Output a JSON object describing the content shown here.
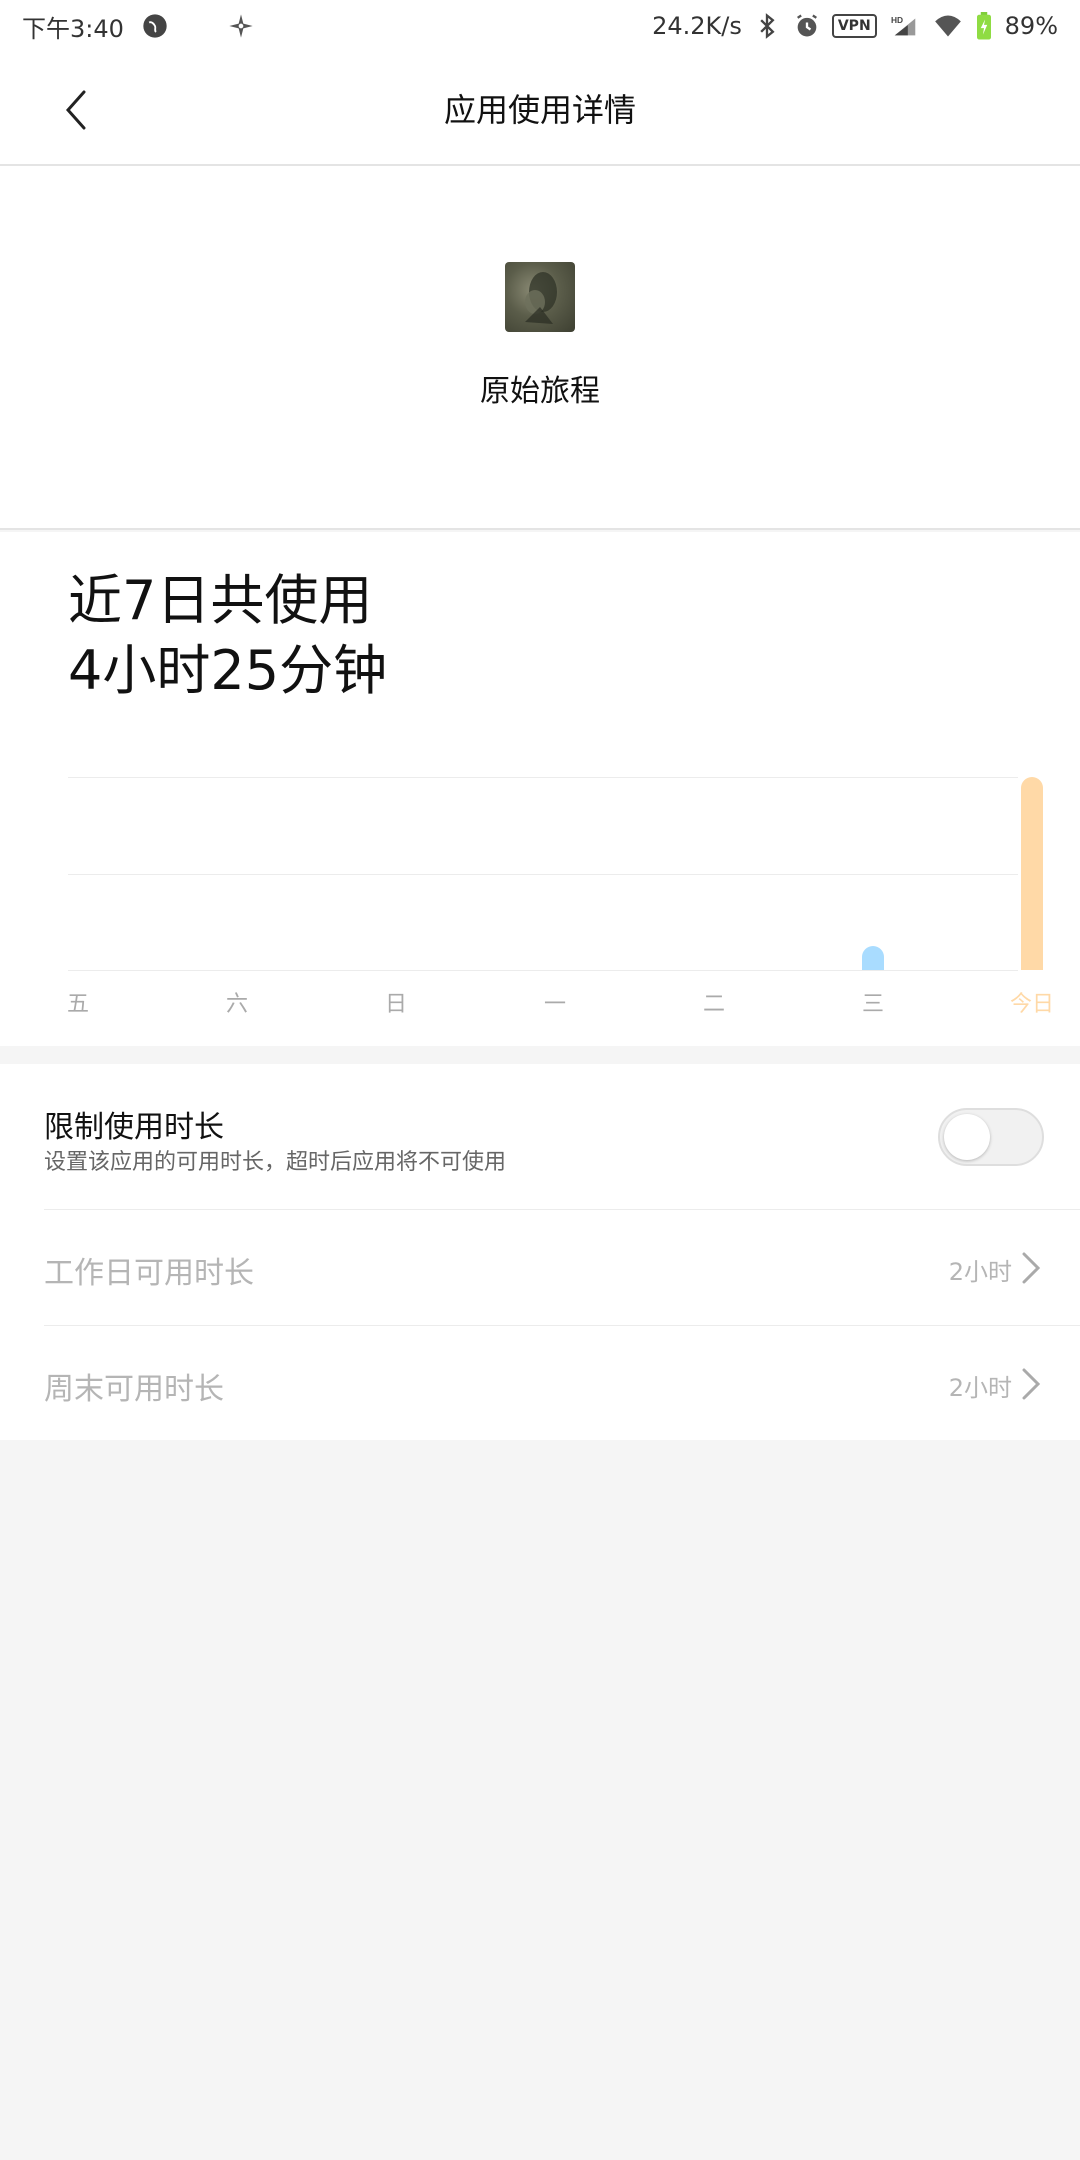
{
  "statusbar": {
    "time": "下午3:40",
    "speed": "24.2K/s",
    "vpn": "VPN",
    "hd": "HD",
    "battery": "89%"
  },
  "header": {
    "title": "应用使用详情"
  },
  "app": {
    "name": "原始旅程"
  },
  "usage": {
    "line1": "近7日共使用",
    "line2": "4小时25分钟"
  },
  "chart_data": {
    "type": "bar",
    "categories": [
      "五",
      "六",
      "日",
      "一",
      "二",
      "三",
      "今日"
    ],
    "series": [
      {
        "values": [
          0,
          0,
          0,
          0,
          0,
          0.25,
          2.0
        ]
      }
    ],
    "colors": {
      "normal": "#a9dcff",
      "today": "#ffd9a7",
      "grid": "#ececec"
    },
    "ylim": [
      0,
      2.0
    ],
    "grid": true
  },
  "limit": {
    "title": "限制使用时长",
    "subtitle": "设置该应用的可用时长，超时后应用将不可使用",
    "enabled": false
  },
  "settings": [
    {
      "label": "工作日可用时长",
      "value": "2小时"
    },
    {
      "label": "周末可用时长",
      "value": "2小时"
    }
  ]
}
